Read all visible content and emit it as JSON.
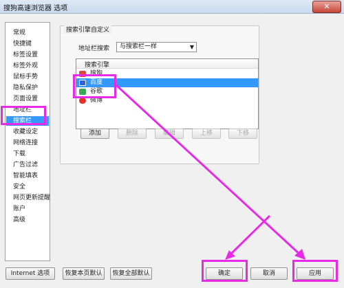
{
  "window": {
    "title": "搜狗高速浏览器 选项",
    "close_glyph": "✕"
  },
  "sidebar": {
    "items": [
      {
        "label": "常规"
      },
      {
        "label": "快捷键"
      },
      {
        "label": "标签设置"
      },
      {
        "label": "标签外观"
      },
      {
        "label": "鼠标手势"
      },
      {
        "label": "隐私保护"
      },
      {
        "label": "页面设置"
      },
      {
        "label": "地址栏"
      },
      {
        "label": "搜索栏",
        "selected": true
      },
      {
        "label": "收藏设定"
      },
      {
        "label": "网络连接"
      },
      {
        "label": "下载"
      },
      {
        "label": "广告过滤"
      },
      {
        "label": "智能填表"
      },
      {
        "label": "安全"
      },
      {
        "label": "网页更新提醒"
      },
      {
        "label": "账户"
      },
      {
        "label": "高级"
      }
    ]
  },
  "panel": {
    "group_title": "搜索引擎自定义",
    "address_search_label": "地址栏搜索",
    "address_search_value": "与搜索栏一样",
    "list_header": "搜索引擎",
    "engines": [
      {
        "label": "搜狗",
        "icon": "sogou-icon",
        "color": "#d94c3d"
      },
      {
        "label": "百度",
        "icon": "baidu-icon",
        "color": "#2a62d8",
        "selected": true
      },
      {
        "label": "谷歌",
        "icon": "google-icon",
        "color": "#3aa757"
      },
      {
        "label": "微博",
        "icon": "weibo-icon",
        "color": "#e0342a"
      }
    ],
    "buttons": {
      "add": "添加",
      "delete": "删除",
      "edit": "编辑",
      "up": "上移",
      "down": "下移"
    }
  },
  "footer": {
    "internet_options": "Internet 选项",
    "restore_page": "恢复本页默认",
    "restore_all": "恢复全部默认",
    "ok": "确定",
    "cancel": "取消",
    "apply": "应用"
  },
  "colors": {
    "highlight": "#e62ae6",
    "selection": "#3399ff"
  }
}
